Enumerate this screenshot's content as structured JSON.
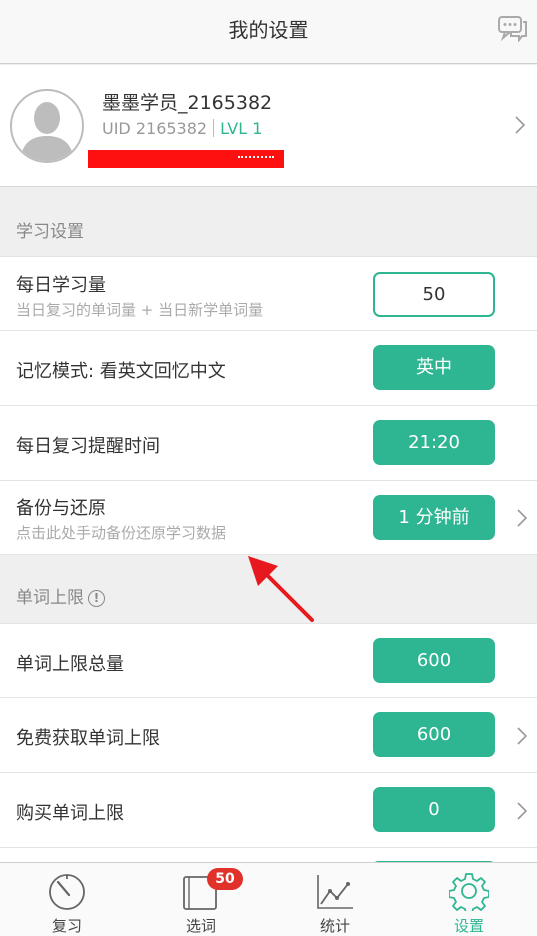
{
  "header": {
    "title": "我的设置",
    "chat_icon": "chat-bubbles-icon"
  },
  "profile": {
    "name": "墨墨学员_2165382",
    "uid": "UID 2165382",
    "level": "LVL 1"
  },
  "study_settings": {
    "section_label": "学习设置",
    "daily_amount": {
      "title": "每日学习量",
      "subtitle": "当日复习的单词量 + 当日新学单词量",
      "value": "50"
    },
    "memory_mode": {
      "title": "记忆模式: 看英文回忆中文",
      "value": "英中"
    },
    "reminder": {
      "title": "每日复习提醒时间",
      "value": "21:20"
    },
    "backup": {
      "title": "备份与还原",
      "subtitle": "点击此处手动备份还原学习数据",
      "value": "1 分钟前"
    }
  },
  "word_limit": {
    "section_label": "单词上限",
    "total": {
      "title": "单词上限总量",
      "value": "600"
    },
    "free": {
      "title": "免费获取单词上限",
      "value": "600"
    },
    "purchased": {
      "title": "购买单词上限",
      "value": "0"
    }
  },
  "tabs": [
    {
      "label": "复习",
      "icon": "timer-icon"
    },
    {
      "label": "选词",
      "icon": "book-icon",
      "badge": "50"
    },
    {
      "label": "统计",
      "icon": "line-chart-icon"
    },
    {
      "label": "设置",
      "icon": "gear-icon",
      "active": true
    }
  ],
  "colors": {
    "accent": "#2eb592",
    "badge": "#e0322a",
    "annotation_arrow": "#e8191e"
  }
}
